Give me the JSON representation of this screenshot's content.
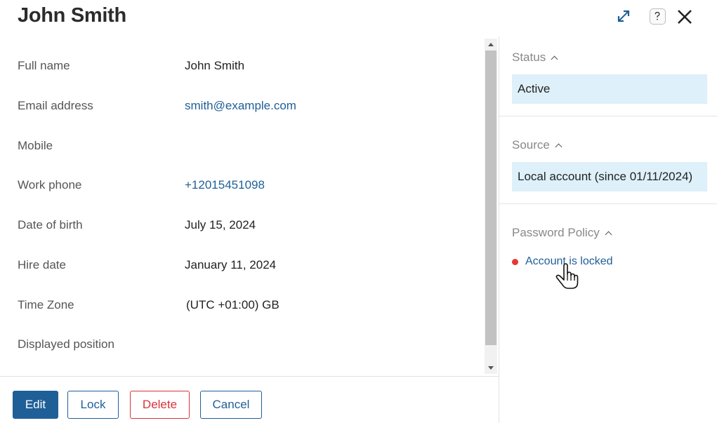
{
  "header": {
    "title": "John Smith"
  },
  "fields": [
    {
      "label": "Full name",
      "value": "John Smith",
      "is_link": false
    },
    {
      "label": "Email address",
      "value": "smith@example.com",
      "is_link": true
    },
    {
      "label": "Mobile",
      "value": "",
      "is_link": false
    },
    {
      "label": "Work phone",
      "value": "+12015451098",
      "is_link": true
    },
    {
      "label": "Date of birth",
      "value": "July 15, 2024",
      "is_link": false
    },
    {
      "label": "Hire date",
      "value": "January 11, 2024",
      "is_link": false
    },
    {
      "label": "Time Zone",
      "value": "(UTC +01:00) GB",
      "is_link": false
    },
    {
      "label": "Displayed position",
      "value": "",
      "is_link": false
    }
  ],
  "footer": {
    "edit_label": "Edit",
    "lock_label": "Lock",
    "delete_label": "Delete",
    "cancel_label": "Cancel"
  },
  "side": {
    "status_header": "Status",
    "status_value": "Active",
    "source_header": "Source",
    "source_value": "Local account (since 01/11/2024)",
    "policy_header": "Password Policy",
    "policy_item": "Account is locked"
  },
  "colors": {
    "primary": "#1f5f97",
    "danger": "#d9333b",
    "status_dot": "#e53935",
    "side_box_bg": "#def0f9"
  },
  "icons": {
    "expand": "expand-icon",
    "help": "help-icon",
    "close": "close-icon"
  }
}
